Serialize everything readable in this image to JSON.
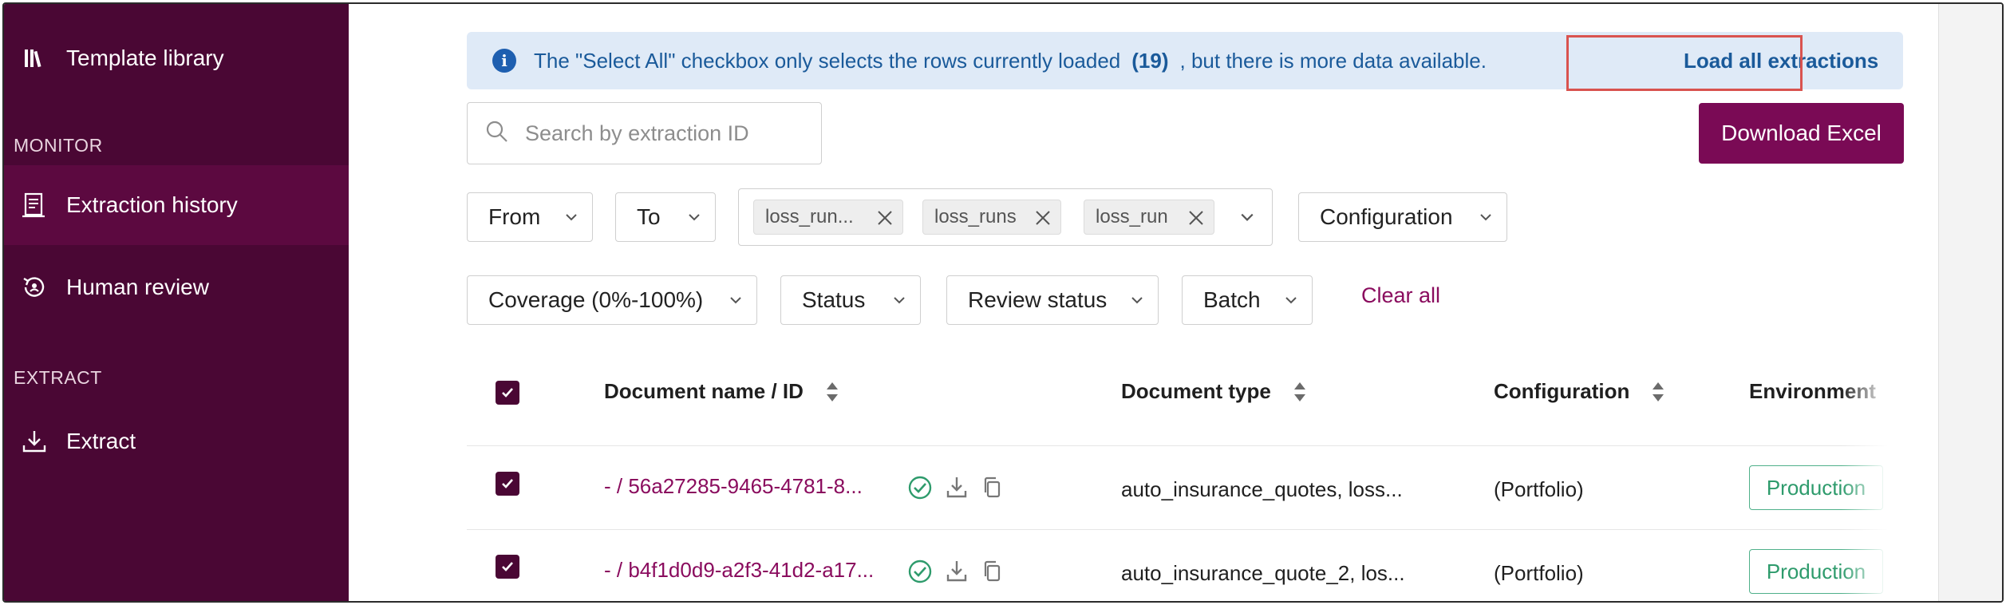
{
  "sidebar": {
    "items": [
      {
        "label": "Template library",
        "icon": "library-icon"
      },
      {
        "label": "Extraction history",
        "icon": "document-history-icon",
        "active": true
      },
      {
        "label": "Human review",
        "icon": "review-history-icon"
      },
      {
        "label": "Extract",
        "icon": "download-icon"
      }
    ],
    "sections": {
      "monitor": "MONITOR",
      "extract": "EXTRACT"
    },
    "colors": {
      "background": "#4a0734",
      "active": "#5c0940"
    }
  },
  "banner": {
    "text_before": "The \"Select All\" checkbox only selects the rows currently loaded",
    "count": "(19)",
    "text_after": ", but there is more data available.",
    "link": "Load all extractions"
  },
  "search": {
    "placeholder": "Search by extraction ID",
    "value": ""
  },
  "toolbar": {
    "download_label": "Download Excel",
    "accent": "#7a0a55"
  },
  "filters": {
    "from": "From",
    "to": "To",
    "tags": [
      "loss_run...",
      "loss_runs",
      "loss_run"
    ],
    "configuration": "Configuration",
    "coverage": "Coverage (0%-100%)",
    "status": "Status",
    "review_status": "Review status",
    "batch": "Batch",
    "clear_all": "Clear all"
  },
  "table": {
    "columns": [
      "Document name / ID",
      "Document type",
      "Configuration",
      "Environment"
    ],
    "rows": [
      {
        "doc": "- / 56a27285-9465-4781-8...",
        "type": "auto_insurance_quotes, loss...",
        "config": "(Portfolio)",
        "env": "Production"
      },
      {
        "doc": "- / b4f1d0d9-a2f3-41d2-a17...",
        "type": "auto_insurance_quote_2, los...",
        "config": "(Portfolio)",
        "env": "Production"
      }
    ]
  }
}
